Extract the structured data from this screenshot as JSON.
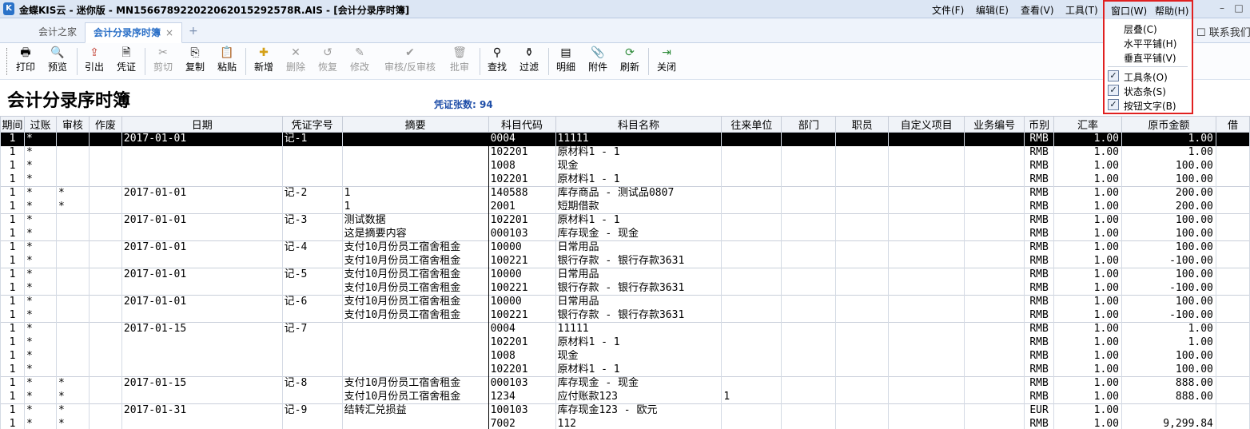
{
  "window": {
    "title": "金蝶KIS云 - 迷你版 - MN15667892202206201529257​8R.AIS - [会计分录序时簿]",
    "menus": [
      "文件(F)",
      "编辑(E)",
      "查看(V)",
      "工具(T)",
      "窗口(W)",
      "帮助(H)"
    ],
    "minimize": "–",
    "maximize": "□"
  },
  "tabs": [
    {
      "label": "会计之家",
      "active": false
    },
    {
      "label": "会计分录序时簿",
      "active": true,
      "close": "×"
    }
  ],
  "tab_add": "+",
  "contact_label": "联系我们",
  "toolbar": [
    {
      "icon": "printer",
      "glyph": "🖶",
      "label": "打印",
      "enabled": true
    },
    {
      "icon": "preview",
      "glyph": "🔍",
      "label": "预览",
      "enabled": true
    },
    {
      "icon": "export",
      "glyph": "⇪",
      "label": "引出",
      "enabled": true
    },
    {
      "icon": "voucher",
      "glyph": "🗎",
      "label": "凭证",
      "enabled": true
    },
    {
      "icon": "cut",
      "glyph": "✂",
      "label": "剪切",
      "enabled": false
    },
    {
      "icon": "copy",
      "glyph": "⎘",
      "label": "复制",
      "enabled": true
    },
    {
      "icon": "paste",
      "glyph": "📋",
      "label": "粘贴",
      "enabled": true
    },
    {
      "icon": "add",
      "glyph": "✚",
      "label": "新增",
      "enabled": true
    },
    {
      "icon": "delete",
      "glyph": "✕",
      "label": "删除",
      "enabled": false
    },
    {
      "icon": "restore",
      "glyph": "↺",
      "label": "恢复",
      "enabled": false
    },
    {
      "icon": "edit",
      "glyph": "✎",
      "label": "修改",
      "enabled": false
    },
    {
      "icon": "audit",
      "glyph": "✔",
      "label": "审核/反审核",
      "enabled": false
    },
    {
      "icon": "approve",
      "glyph": "🗑",
      "label": "批审",
      "enabled": false
    },
    {
      "icon": "find",
      "glyph": "⚲",
      "label": "查找",
      "enabled": true
    },
    {
      "icon": "filter",
      "glyph": "⚱",
      "label": "过滤",
      "enabled": true
    },
    {
      "icon": "detail",
      "glyph": "▤",
      "label": "明细",
      "enabled": true
    },
    {
      "icon": "attachment",
      "glyph": "📎",
      "label": "附件",
      "enabled": true
    },
    {
      "icon": "refresh",
      "glyph": "⟳",
      "label": "刷新",
      "enabled": true
    },
    {
      "icon": "close",
      "glyph": "⇥",
      "label": "关闭",
      "enabled": true
    }
  ],
  "page_title": "会计分录序时簿",
  "voucher_count": "凭证张数: 94",
  "columns": [
    "期间",
    "过账",
    "审核",
    "作废",
    "日期",
    "凭证字号",
    "摘要",
    "科目代码",
    "科目名称",
    "往来单位",
    "部门",
    "职员",
    "自定义项目",
    "业务编号",
    "币别",
    "汇率",
    "原币金额",
    "借"
  ],
  "rows": [
    {
      "period": "1",
      "posted": "*",
      "audited": "",
      "void": "",
      "date": "2017-01-01",
      "voucher": "记-1",
      "summary": "",
      "code": "0004",
      "account": "11111",
      "partner": "",
      "currency": "RMB",
      "rate": "1.00",
      "amount": "1.00",
      "start": true,
      "selected": true
    },
    {
      "period": "1",
      "posted": "*",
      "audited": "",
      "void": "",
      "date": "",
      "voucher": "",
      "summary": "",
      "code": "102201",
      "account": "原材料1 - 1",
      "partner": "",
      "currency": "RMB",
      "rate": "1.00",
      "amount": "1.00"
    },
    {
      "period": "1",
      "posted": "*",
      "audited": "",
      "void": "",
      "date": "",
      "voucher": "",
      "summary": "",
      "code": "1008",
      "account": "现金",
      "partner": "",
      "currency": "RMB",
      "rate": "1.00",
      "amount": "100.00"
    },
    {
      "period": "1",
      "posted": "*",
      "audited": "",
      "void": "",
      "date": "",
      "voucher": "",
      "summary": "",
      "code": "102201",
      "account": "原材料1 - 1",
      "partner": "",
      "currency": "RMB",
      "rate": "1.00",
      "amount": "100.00"
    },
    {
      "period": "1",
      "posted": "*",
      "audited": "*",
      "void": "",
      "date": "2017-01-01",
      "voucher": "记-2",
      "summary": "1",
      "code": "140588",
      "account": "库存商品 - 测试品0807",
      "partner": "",
      "currency": "RMB",
      "rate": "1.00",
      "amount": "200.00",
      "start": true
    },
    {
      "period": "1",
      "posted": "*",
      "audited": "*",
      "void": "",
      "date": "",
      "voucher": "",
      "summary": "1",
      "code": "2001",
      "account": "短期借款",
      "partner": "",
      "currency": "RMB",
      "rate": "1.00",
      "amount": "200.00"
    },
    {
      "period": "1",
      "posted": "*",
      "audited": "",
      "void": "",
      "date": "2017-01-01",
      "voucher": "记-3",
      "summary": "测试数据",
      "code": "102201",
      "account": "原材料1 - 1",
      "partner": "",
      "currency": "RMB",
      "rate": "1.00",
      "amount": "100.00",
      "start": true
    },
    {
      "period": "1",
      "posted": "*",
      "audited": "",
      "void": "",
      "date": "",
      "voucher": "",
      "summary": "这是摘要内容",
      "code": "000103",
      "account": "库存现金 - 现金",
      "partner": "",
      "currency": "RMB",
      "rate": "1.00",
      "amount": "100.00"
    },
    {
      "period": "1",
      "posted": "*",
      "audited": "",
      "void": "",
      "date": "2017-01-01",
      "voucher": "记-4",
      "summary": "支付10月份员工宿舍租金",
      "code": "10000",
      "account": "日常用品",
      "partner": "",
      "currency": "RMB",
      "rate": "1.00",
      "amount": "100.00",
      "start": true
    },
    {
      "period": "1",
      "posted": "*",
      "audited": "",
      "void": "",
      "date": "",
      "voucher": "",
      "summary": "支付10月份员工宿舍租金",
      "code": "100221",
      "account": "银行存款 - 银行存款3631",
      "partner": "",
      "currency": "RMB",
      "rate": "1.00",
      "amount": "-100.00"
    },
    {
      "period": "1",
      "posted": "*",
      "audited": "",
      "void": "",
      "date": "2017-01-01",
      "voucher": "记-5",
      "summary": "支付10月份员工宿舍租金",
      "code": "10000",
      "account": "日常用品",
      "partner": "",
      "currency": "RMB",
      "rate": "1.00",
      "amount": "100.00",
      "start": true
    },
    {
      "period": "1",
      "posted": "*",
      "audited": "",
      "void": "",
      "date": "",
      "voucher": "",
      "summary": "支付10月份员工宿舍租金",
      "code": "100221",
      "account": "银行存款 - 银行存款3631",
      "partner": "",
      "currency": "RMB",
      "rate": "1.00",
      "amount": "-100.00"
    },
    {
      "period": "1",
      "posted": "*",
      "audited": "",
      "void": "",
      "date": "2017-01-01",
      "voucher": "记-6",
      "summary": "支付10月份员工宿舍租金",
      "code": "10000",
      "account": "日常用品",
      "partner": "",
      "currency": "RMB",
      "rate": "1.00",
      "amount": "100.00",
      "start": true
    },
    {
      "period": "1",
      "posted": "*",
      "audited": "",
      "void": "",
      "date": "",
      "voucher": "",
      "summary": "支付10月份员工宿舍租金",
      "code": "100221",
      "account": "银行存款 - 银行存款3631",
      "partner": "",
      "currency": "RMB",
      "rate": "1.00",
      "amount": "-100.00"
    },
    {
      "period": "1",
      "posted": "*",
      "audited": "",
      "void": "",
      "date": "2017-01-15",
      "voucher": "记-7",
      "summary": "",
      "code": "0004",
      "account": "11111",
      "partner": "",
      "currency": "RMB",
      "rate": "1.00",
      "amount": "1.00",
      "start": true
    },
    {
      "period": "1",
      "posted": "*",
      "audited": "",
      "void": "",
      "date": "",
      "voucher": "",
      "summary": "",
      "code": "102201",
      "account": "原材料1 - 1",
      "partner": "",
      "currency": "RMB",
      "rate": "1.00",
      "amount": "1.00"
    },
    {
      "period": "1",
      "posted": "*",
      "audited": "",
      "void": "",
      "date": "",
      "voucher": "",
      "summary": "",
      "code": "1008",
      "account": "现金",
      "partner": "",
      "currency": "RMB",
      "rate": "1.00",
      "amount": "100.00"
    },
    {
      "period": "1",
      "posted": "*",
      "audited": "",
      "void": "",
      "date": "",
      "voucher": "",
      "summary": "",
      "code": "102201",
      "account": "原材料1 - 1",
      "partner": "",
      "currency": "RMB",
      "rate": "1.00",
      "amount": "100.00"
    },
    {
      "period": "1",
      "posted": "*",
      "audited": "*",
      "void": "",
      "date": "2017-01-15",
      "voucher": "记-8",
      "summary": "支付10月份员工宿舍租金",
      "code": "000103",
      "account": "库存现金 - 现金",
      "partner": "",
      "currency": "RMB",
      "rate": "1.00",
      "amount": "888.00",
      "start": true
    },
    {
      "period": "1",
      "posted": "*",
      "audited": "*",
      "void": "",
      "date": "",
      "voucher": "",
      "summary": "支付10月份员工宿舍租金",
      "code": "1234",
      "account": "应付账款123",
      "partner": "1",
      "currency": "RMB",
      "rate": "1.00",
      "amount": "888.00"
    },
    {
      "period": "1",
      "posted": "*",
      "audited": "*",
      "void": "",
      "date": "2017-01-31",
      "voucher": "记-9",
      "summary": "结转汇兑损益",
      "code": "100103",
      "account": "库存现金123 - 欧元",
      "partner": "",
      "currency": "EUR",
      "rate": "1.00",
      "amount": "",
      "start": true
    },
    {
      "period": "1",
      "posted": "*",
      "audited": "*",
      "void": "",
      "date": "",
      "voucher": "",
      "summary": "",
      "code": "7002",
      "account": "112",
      "partner": "",
      "currency": "RMB",
      "rate": "1.00",
      "amount": "9,299.84"
    }
  ],
  "window_menu": {
    "header_left": "窗口(W)",
    "header_right": "帮助(H)",
    "items": [
      "层叠(C)",
      "水平平铺(H)",
      "垂直平铺(V)"
    ],
    "checks": [
      {
        "label": "工具条(O)",
        "checked": true
      },
      {
        "label": "状态条(S)",
        "checked": true
      },
      {
        "label": "按钮文字(B)",
        "checked": true
      }
    ],
    "highlight_color": "#e02020"
  },
  "colors": {
    "accent": "#2a6fc7",
    "title_bar": "#dce6f4"
  }
}
